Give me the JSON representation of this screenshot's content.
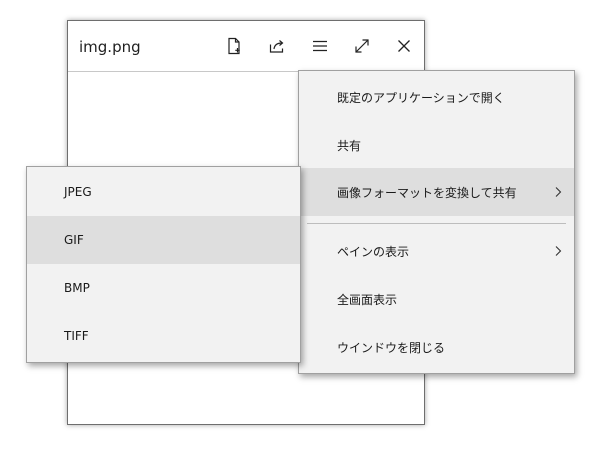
{
  "window": {
    "title": "img.png",
    "toolbar_icons": [
      "new-document-icon",
      "share-icon",
      "hamburger-menu-icon",
      "expand-icon",
      "close-icon"
    ]
  },
  "context_menu": {
    "items": [
      {
        "label": "既定のアプリケーションで開く"
      },
      {
        "label": "共有"
      },
      {
        "label": "画像フォーマットを変換して共有",
        "has_submenu": true,
        "highlighted": true
      },
      {
        "label": "ペインの表示",
        "has_submenu": true
      },
      {
        "label": "全画面表示"
      },
      {
        "label": "ウインドウを閉じる"
      }
    ]
  },
  "format_submenu": {
    "items": [
      {
        "label": "JPEG"
      },
      {
        "label": "GIF",
        "highlighted": true
      },
      {
        "label": "BMP"
      },
      {
        "label": "TIFF"
      }
    ]
  },
  "colors": {
    "menu_bg": "#f2f2f2",
    "highlight_bg": "#dedede",
    "text": "#1a1a1a",
    "border": "#a0a0a0"
  }
}
